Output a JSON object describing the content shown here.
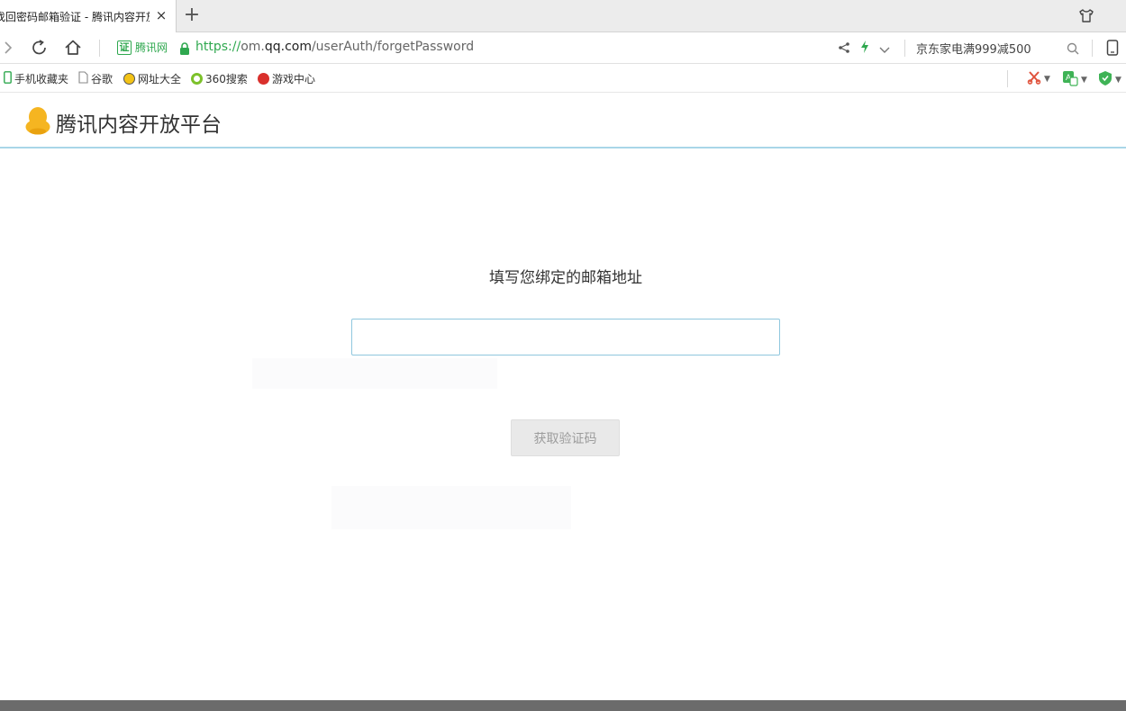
{
  "tab": {
    "title": "找回密码邮箱验证 - 腾讯内容开放平台",
    "close_glyph": "×",
    "new_tab_glyph": "+"
  },
  "address_bar": {
    "cert_glyph": "证",
    "cert_label": "腾讯网",
    "url_scheme": "https://",
    "url_prefix": "om.",
    "url_domain": "qq.com",
    "url_path": "/userAuth/forgetPassword",
    "promo_text": "京东家电满999减500"
  },
  "bookmarks": [
    {
      "label": "手机收藏夹",
      "icon": "phone-icon"
    },
    {
      "label": "谷歌",
      "icon": "page-icon"
    },
    {
      "label": "网址大全",
      "icon": "nav-site-icon"
    },
    {
      "label": "360搜索",
      "icon": "search360-icon"
    },
    {
      "label": "游戏中心",
      "icon": "game-icon"
    }
  ],
  "header": {
    "site_name": "腾讯内容开放平台"
  },
  "main": {
    "title": "填写您绑定的邮箱地址",
    "email_value": "",
    "submit_label": "获取验证码"
  },
  "colors": {
    "accent_green": "#2fa84f",
    "header_border": "#a9d6e8",
    "input_border": "#8fc7de",
    "button_disabled_bg": "#e9e9e9"
  }
}
